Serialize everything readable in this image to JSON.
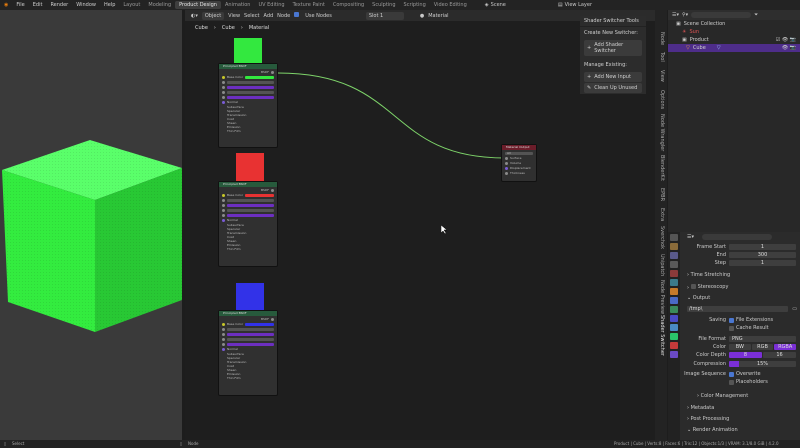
{
  "topbar": {
    "menus": [
      "File",
      "Edit",
      "Render",
      "Window",
      "Help"
    ],
    "workspaces": [
      "Layout",
      "Modeling",
      "Product Design",
      "Animation",
      "UV Editing",
      "Texture Paint",
      "Compositing",
      "Sculpting",
      "Scripting",
      "Video Editing"
    ],
    "active_workspace": "Product Design",
    "scene": "Scene",
    "view_layer": "View Layer"
  },
  "node_editor": {
    "mode": "Object",
    "menus": [
      "View",
      "Select",
      "Add",
      "Node"
    ],
    "use_nodes": "Use Nodes",
    "slot": "Slot 1",
    "material": "Material",
    "breadcrumb": [
      "Cube",
      "Cube",
      "Material"
    ],
    "nodes": [
      {
        "title": "Principled BSDF",
        "color": "#33e83f",
        "output": "BSDF"
      },
      {
        "title": "Principled BSDF",
        "color": "#e83232",
        "output": "BSDF"
      },
      {
        "title": "Principled BSDF",
        "color": "#3232e8",
        "output": "BSDF"
      }
    ],
    "node_rows": [
      "Base Color",
      "Metallic",
      "Roughness",
      "IOR",
      "Alpha",
      "Normal"
    ],
    "node_subs": [
      "Subsurface",
      "Specular",
      "Transmission",
      "Coat",
      "Sheen",
      "Emission",
      "Thin Film"
    ],
    "output_node": {
      "title": "Material Output",
      "target": "All",
      "sockets": [
        "Surface",
        "Volume",
        "Displacement",
        "Thickness"
      ]
    }
  },
  "shader_panel": {
    "title": "Shader Switcher Tools",
    "create": "Create New Switcher:",
    "add": "Add Shader Switcher",
    "manage": "Manage Existing:",
    "add_input": "Add New Input",
    "clean": "Clean Up Unused"
  },
  "side_tabs": [
    "Node",
    "Tool",
    "View",
    "Options",
    "Node Wrangler",
    "BlenderKit",
    "EPBR",
    "Extra",
    "Sverchok",
    "Unipatch",
    "Node Preview",
    "Shader Switcher"
  ],
  "outliner": {
    "search_placeholder": "",
    "items": [
      "Scene Collection",
      "Sun",
      "Product",
      "Cube"
    ]
  },
  "properties": {
    "search_placeholder": "",
    "frame_start_label": "Frame Start",
    "frame_start": "1",
    "end_label": "End",
    "end": "300",
    "step_label": "Step",
    "step": "1",
    "time_stretching": "Time Stretching",
    "stereoscopy": "Stereoscopy",
    "output": "Output",
    "path": "/tmp\\",
    "saving_label": "Saving",
    "file_extensions": "File Extensions",
    "cache_result": "Cache Result",
    "file_format_label": "File Format",
    "file_format": "PNG",
    "color_label": "Color",
    "color_modes": [
      "BW",
      "RGB",
      "RGBA"
    ],
    "color_depth_label": "Color Depth",
    "depth_8": "8",
    "depth_16": "16",
    "compression_label": "Compression",
    "compression": "15%",
    "image_sequence_label": "Image Sequence",
    "overwrite": "Overwrite",
    "placeholders": "Placeholders",
    "color_management": "Color Management",
    "metadata": "Metadata",
    "post_processing": "Post Processing",
    "render_animation": "Render Animation"
  },
  "statusbar": {
    "left": "Select",
    "mid": "Node",
    "right": "Product | Cube | Verts:8 | Faces:6 | Tris:12 | Objects:1/3 | VRAM: 3.1/8.0 GiB | 4.2.0"
  }
}
